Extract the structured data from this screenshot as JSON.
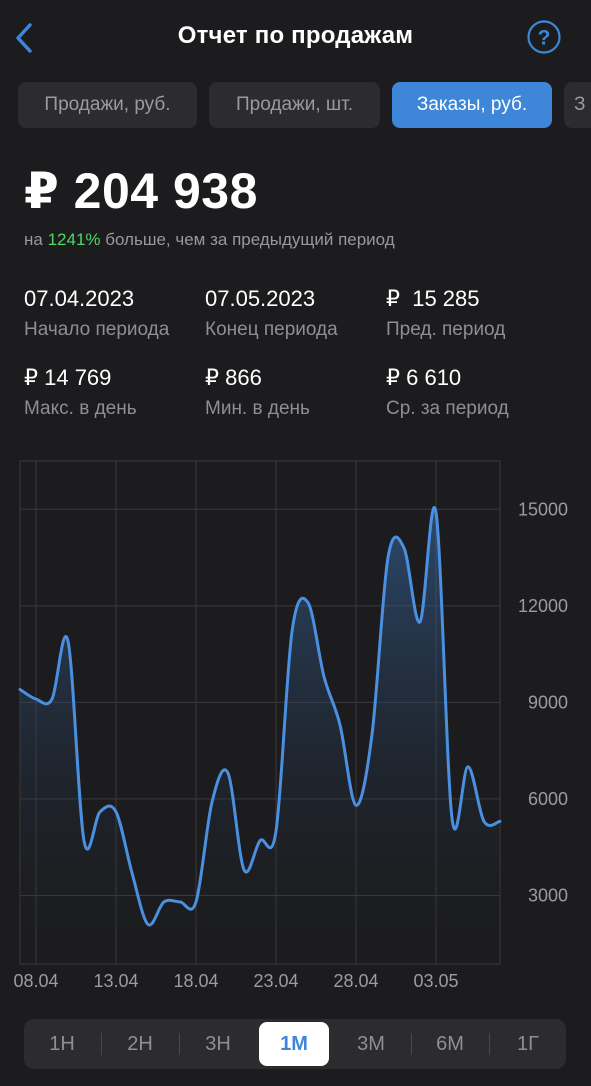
{
  "header": {
    "title": "Отчет по продажам"
  },
  "tabs": [
    {
      "label": "Продажи, руб.",
      "active": false
    },
    {
      "label": "Продажи, шт.",
      "active": false
    },
    {
      "label": "Заказы, руб.",
      "active": true
    },
    {
      "label": "З",
      "active": false
    }
  ],
  "summary": {
    "total": "₽ 204 938",
    "compare_prefix": "на ",
    "compare_pct": "1241%",
    "compare_suffix": " больше, чем за предыдущий период"
  },
  "stats": [
    {
      "value": "07.04.2023",
      "label": "Начало периода"
    },
    {
      "value": "07.05.2023",
      "label": "Конец периода"
    },
    {
      "value": "₽  15 285",
      "label": "Пред. период"
    },
    {
      "value": "₽ 14 769",
      "label": "Макс. в день"
    },
    {
      "value": "₽ 866",
      "label": "Мин. в день"
    },
    {
      "value": "₽ 6 610",
      "label": "Ср. за период"
    }
  ],
  "colors": {
    "accent": "#3d86d8",
    "positive": "#4cd964",
    "line": "#4a8fe0"
  },
  "chart_data": {
    "type": "line",
    "x": [
      "07.04",
      "08.04",
      "09.04",
      "10.04",
      "11.04",
      "12.04",
      "13.04",
      "14.04",
      "15.04",
      "16.04",
      "17.04",
      "18.04",
      "19.04",
      "20.04",
      "21.04",
      "22.04",
      "23.04",
      "24.04",
      "25.04",
      "26.04",
      "27.04",
      "28.04",
      "29.04",
      "30.04",
      "01.05",
      "02.05",
      "03.05",
      "04.05",
      "05.05",
      "06.05",
      "07.05"
    ],
    "series": [
      {
        "values": [
          9400,
          9100,
          9100,
          10900,
          4700,
          5600,
          5600,
          3700,
          2100,
          2800,
          2800,
          2800,
          5900,
          6800,
          3800,
          4700,
          5000,
          11200,
          12100,
          9800,
          8300,
          5800,
          8000,
          13500,
          13800,
          11500,
          14900,
          5400,
          7000,
          5300,
          5300
        ]
      }
    ],
    "x_ticks": [
      "08.04",
      "13.04",
      "18.04",
      "23.04",
      "28.04",
      "03.05"
    ],
    "y_ticks": [
      3000,
      6000,
      9000,
      12000,
      15000
    ],
    "ylim": [
      870,
      16500
    ],
    "grid": true
  },
  "periods": [
    {
      "label": "1Н",
      "active": false
    },
    {
      "label": "2Н",
      "active": false
    },
    {
      "label": "3Н",
      "active": false
    },
    {
      "label": "1М",
      "active": true
    },
    {
      "label": "3М",
      "active": false
    },
    {
      "label": "6М",
      "active": false
    },
    {
      "label": "1Г",
      "active": false
    }
  ]
}
